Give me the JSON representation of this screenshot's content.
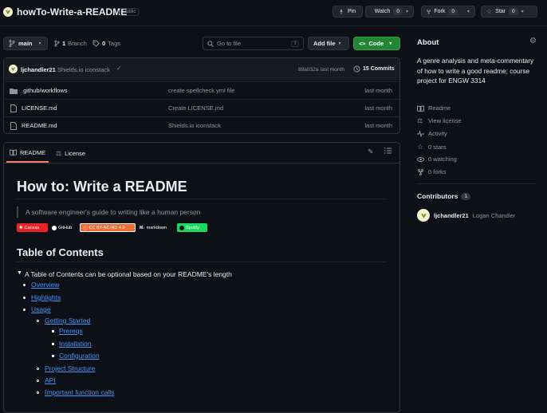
{
  "repo": {
    "name": "howTo-Write-a-README",
    "visibility": "Public",
    "pin_label": "Pin",
    "watch_label": "Watch",
    "watch_count": "0",
    "fork_label": "Fork",
    "fork_count": "0",
    "star_label": "Star",
    "star_count": "0"
  },
  "toolbar": {
    "branch": "main",
    "branch_count": "1",
    "branch_label": "Branch",
    "tag_count": "0",
    "tag_label": "Tags",
    "go_to_file_placeholder": "Go to file",
    "go_to_file_shortcut": "t",
    "add_file_label": "Add file",
    "code_label": "Code"
  },
  "commit": {
    "author": "ljchandler21",
    "message": "Shields.io iconstack",
    "hash": "89a032a",
    "time": "· last month",
    "commits_count": "15 Commits"
  },
  "files": [
    {
      "name": ".github/workflows",
      "type": "folder",
      "message": "create spellcheck yml file",
      "time": "last month"
    },
    {
      "name": "LICENSE.md",
      "type": "file",
      "message": "Create LICENSE.md",
      "time": "last month"
    },
    {
      "name": "README.md",
      "type": "file",
      "message": "Shields.io iconstack",
      "time": "last month"
    }
  ],
  "readme_tabs": {
    "readme": "README",
    "license": "License"
  },
  "readme": {
    "title": "How to: Write a README",
    "subtitle": "A software engineer's guide to writing like a human person",
    "badges": [
      "Canvas",
      "GitHub",
      "CC BY-NC-ND 4.0",
      "markdown",
      "Spotify"
    ],
    "toc_heading": "Table of Contents",
    "toc_summary": "A Table of Contents can be optional based on your README's length",
    "toc": {
      "overview": "Overview",
      "highlights": "Highlights",
      "usage": "Usage",
      "getting_started": "Getting Started",
      "prereqs": "Prereqs",
      "installation": "Installation",
      "configuration": "Configuration",
      "project_structure": "Project Structure",
      "api": "API",
      "important_function_calls": "Important function calls"
    }
  },
  "about": {
    "heading": "About",
    "description": "A genre analysis and meta-commentary of how to write a good readme; course project for ENGW 3314",
    "readme_link": "Readme",
    "license_link": "View license",
    "activity_link": "Activity",
    "stars": "0 stars",
    "watching": "0 watching",
    "forks": "0 forks"
  },
  "contributors": {
    "heading": "Contributors",
    "count": "1",
    "user": "ljchandler21",
    "full_name": "Logan Chandler"
  },
  "colors": {
    "background": "#0d1117",
    "border": "#30363d",
    "link": "#4493f8",
    "code_button": "#238636",
    "badge_canvas": "#e72429",
    "badge_cc": "#ef6b36",
    "badge_spotify": "#1ed760"
  }
}
